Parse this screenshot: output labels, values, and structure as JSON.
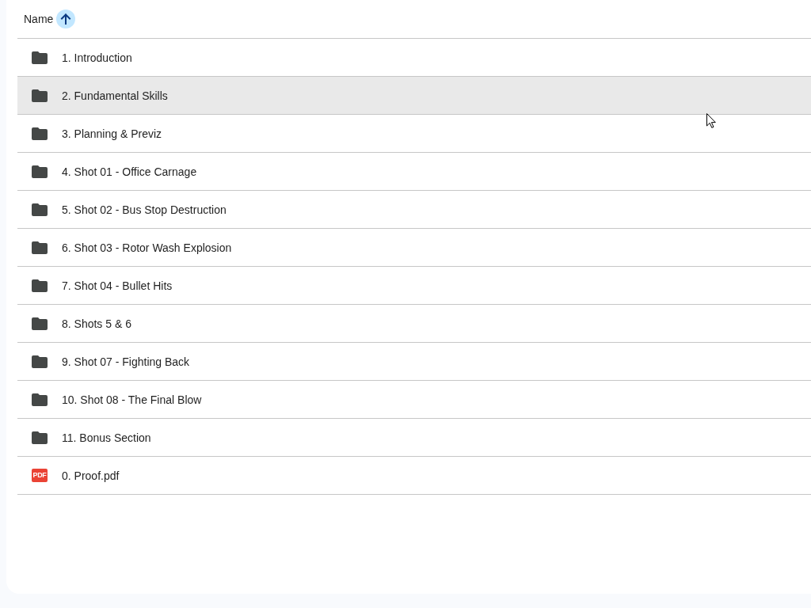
{
  "header": {
    "column": "Name",
    "ascending": true
  },
  "files": [
    {
      "kind": "folder",
      "name": "1. Introduction",
      "highlighted": false
    },
    {
      "kind": "folder",
      "name": "2. Fundamental Skills",
      "highlighted": true
    },
    {
      "kind": "folder",
      "name": "3. Planning & Previz",
      "highlighted": false
    },
    {
      "kind": "folder",
      "name": "4. Shot 01 - Office Carnage",
      "highlighted": false
    },
    {
      "kind": "folder",
      "name": "5. Shot 02 - Bus Stop Destruction",
      "highlighted": false
    },
    {
      "kind": "folder",
      "name": "6. Shot 03 - Rotor Wash Explosion",
      "highlighted": false
    },
    {
      "kind": "folder",
      "name": "7. Shot 04 - Bullet Hits",
      "highlighted": false
    },
    {
      "kind": "folder",
      "name": "8. Shots 5 & 6",
      "highlighted": false
    },
    {
      "kind": "folder",
      "name": "9. Shot 07 - Fighting Back",
      "highlighted": false
    },
    {
      "kind": "folder",
      "name": "10. Shot 08 - The Final Blow",
      "highlighted": false
    },
    {
      "kind": "folder",
      "name": "11. Bonus Section",
      "highlighted": false
    },
    {
      "kind": "pdf",
      "name": "0. Proof.pdf",
      "highlighted": false,
      "icon_text": "PDF"
    }
  ]
}
